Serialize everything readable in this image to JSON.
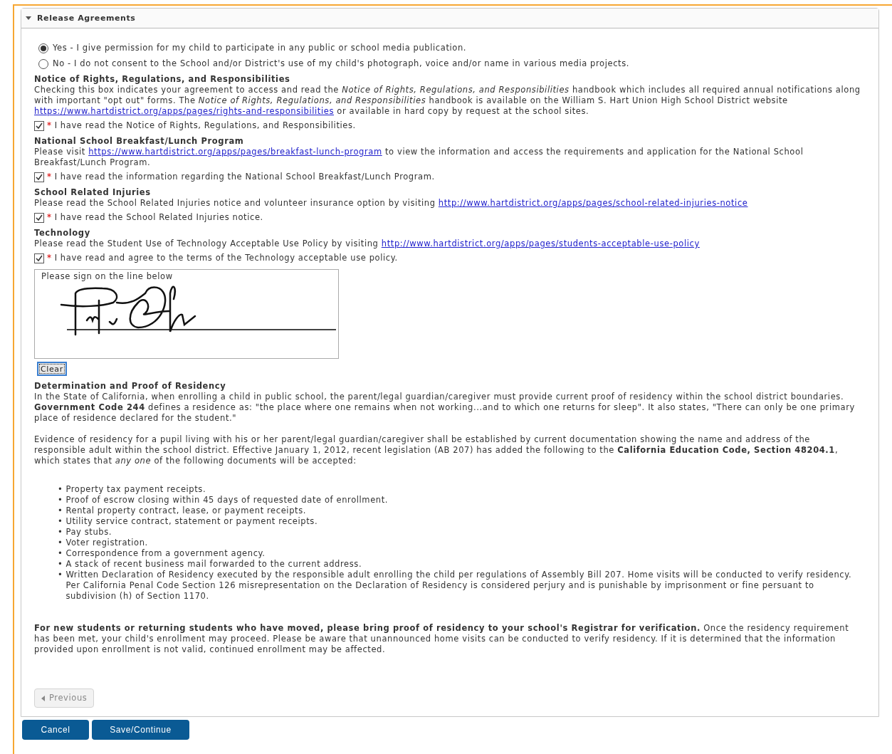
{
  "panel": {
    "title": "Release Agreements",
    "expanded": true
  },
  "media_consent": [
    {
      "label": "Yes - I give permission for my child to participate in any public or school media publication.",
      "selected": true
    },
    {
      "label": "No - I do not consent to the School and/or District's use of my child's photograph, voice and/or name in various media projects.",
      "selected": false
    }
  ],
  "agreements": [
    {
      "heading": "Notice of Rights, Regulations, and Responsibilities",
      "body": [
        {
          "kind": "text",
          "text": "Checking this box indicates your agreement to access and read the *Notice of Rights, Regulations, and Responsibilities* handbook which includes all required annual notifications along with important \"opt out\" forms. The *Notice of Rights, Regulations, and Responsibilities* handbook is available on the William S. Hart Union High School District website "
        },
        {
          "kind": "link",
          "text": "https://www.hartdistrict.org/apps/pages/rights-and-responsibilities"
        },
        {
          "kind": "text",
          "text": " or available in hard copy by request at the school sites."
        }
      ],
      "checkbox": {
        "label": "I have read the Notice of Rights, Regulations, and Responsibilities.",
        "checked": true,
        "required_mark": "*"
      }
    },
    {
      "heading": "National School Breakfast/Lunch Program",
      "body": [
        {
          "kind": "text",
          "text": "Please visit "
        },
        {
          "kind": "link",
          "text": "https://www.hartdistrict.org/apps/pages/breakfast-lunch-program"
        },
        {
          "kind": "text",
          "text": " to view the information and access the requirements and application for the National School Breakfast/Lunch Program."
        }
      ],
      "checkbox": {
        "label": "I have read the information regarding the National School Breakfast/Lunch Program.",
        "checked": true,
        "required_mark": "*"
      }
    },
    {
      "heading": "School Related Injuries",
      "body": [
        {
          "kind": "text",
          "text": "Please read the School Related Injuries notice and volunteer insurance option by visiting "
        },
        {
          "kind": "link",
          "text": "http://www.hartdistrict.org/apps/pages/school-related-injuries-notice"
        }
      ],
      "checkbox": {
        "label": "I have read the School Related Injuries notice.",
        "checked": true,
        "required_mark": "*"
      }
    },
    {
      "heading": "Technology",
      "body": [
        {
          "kind": "text",
          "text": "Please read the Student Use of Technology Acceptable Use Policy by visiting "
        },
        {
          "kind": "link",
          "text": "http://www.hartdistrict.org/apps/pages/students-acceptable-use-policy"
        }
      ],
      "checkbox": {
        "label": "I have read and agree to the terms of the Technology acceptable use policy.",
        "checked": true,
        "required_mark": "*"
      }
    }
  ],
  "signature": {
    "prompt": "Please sign on the line below",
    "signed": true,
    "clear_button": "Clear"
  },
  "residency": {
    "heading": "Determination and Proof of Residency",
    "paragraphs": [
      "In the State of California, when enrolling a child in public school, the parent/legal guardian/caregiver must provide current proof of residency within the school district boundaries. **Government Code 244** defines a residence as: \"the place where one remains when not working...and to which one returns for sleep\". It also states, \"There can only be one primary place of residence declared for the student.\"",
      "Evidence of residency for a pupil living with his or her parent/legal guardian/caregiver shall be established by current documentation showing the name and address of the responsible adult within the school district. Effective January 1, 2012, recent legislation (AB 207) has added the following to the **California Education Code, Section 48204.1**, which states that *any one* of the following documents will be accepted:"
    ],
    "bullet": "•",
    "documents": [
      "Property tax payment receipts.",
      "Proof of escrow closing within 45 days of requested date of enrollment.",
      "Rental property contract, lease, or payment receipts.",
      "Utility service contract, statement or payment receipts.",
      "Pay stubs.",
      "Voter registration.",
      "Correspondence from a government agency.",
      "A stack of recent business mail forwarded to the current address.",
      "Written Declaration of Residency executed by the responsible adult enrolling the child per regulations of Assembly Bill 207. Home visits will be conducted to verify residency. Per California Penal Code Section 126 misrepresentation on the Declaration of Residency is considered perjury and is punishable by imprisonment or fine persuant to subdivision (h) of Section 1170."
    ],
    "closing": "**For new students or returning students who have moved, please bring proof of residency to your school's Registrar for verification.** Once the residency requirement has been met, your child's enrollment may proceed. Please be aware that unannounced home visits can be conducted to verify residency. If it is determined that the information provided upon enrollment is not valid, continued enrollment may be affected."
  },
  "previous_button": {
    "label": "Previous",
    "disabled": true
  },
  "footer_buttons": [
    "Cancel",
    "Save/Continue"
  ]
}
